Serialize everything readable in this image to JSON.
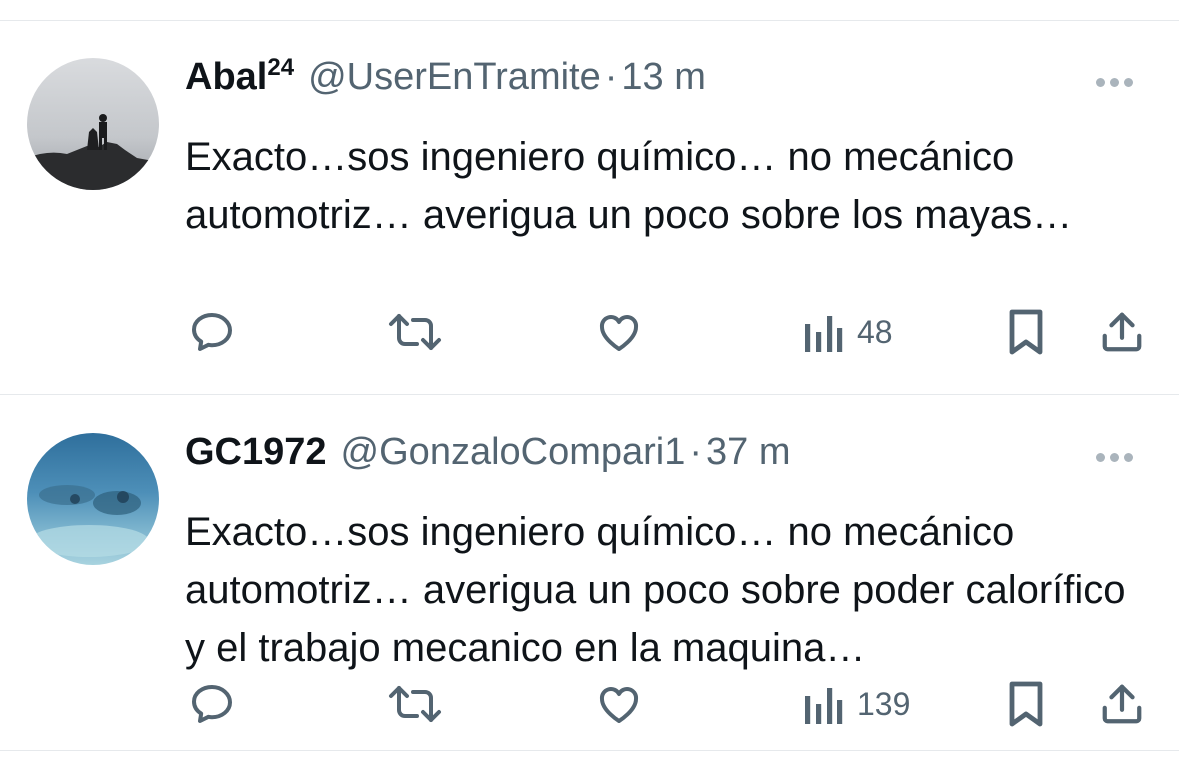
{
  "tweets": [
    {
      "name": "Abal",
      "name_sup": "24",
      "handle": "@UserEnTramite",
      "separator": "·",
      "time": "13 m",
      "text": "Exacto…sos ingeniero químico… no mecánico automotriz… averigua un poco sobre los mayas…",
      "views": "48",
      "icons": [
        "reply-icon",
        "retweet-icon",
        "like-icon",
        "views-icon",
        "bookmark-icon",
        "share-icon",
        "more-icon"
      ]
    },
    {
      "name": "GC1972",
      "name_sup": "",
      "handle": "@GonzaloCompari1",
      "separator": "·",
      "time": "37 m",
      "text": "Exacto…sos ingeniero químico… no mecánico automotriz… averigua un poco sobre poder calorífico y el trabajo mecanico en la maquina…",
      "views": "139",
      "icons": [
        "reply-icon",
        "retweet-icon",
        "like-icon",
        "views-icon",
        "bookmark-icon",
        "share-icon",
        "more-icon"
      ]
    }
  ],
  "colors": {
    "text": "#0f1419",
    "secondary": "#536471",
    "divider": "#e6e9ec",
    "background": "#ffffff"
  }
}
